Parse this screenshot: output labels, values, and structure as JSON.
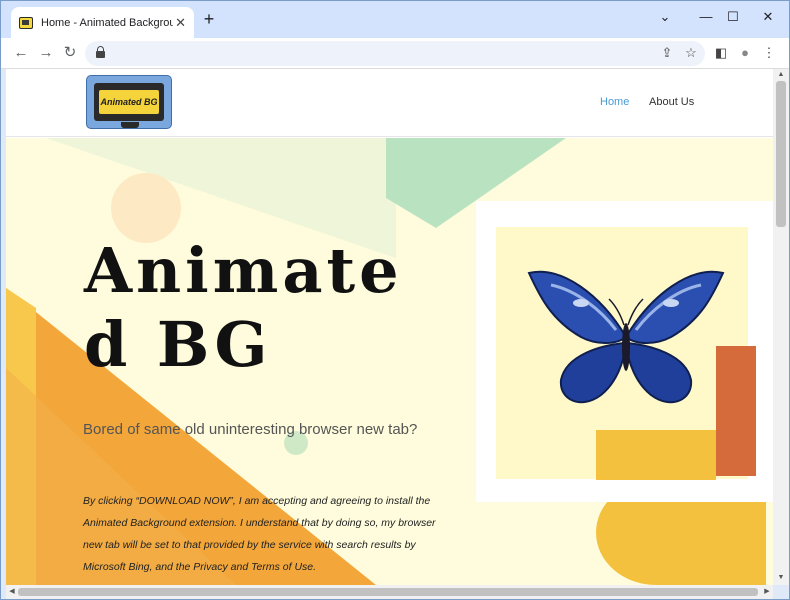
{
  "browser": {
    "tab_title": "Home - Animated Background Ta",
    "tab_close": "✕",
    "new_tab": "+",
    "minimize": "⌄",
    "min_icon": "—",
    "maximize": "☐",
    "close": "✕",
    "back": "←",
    "forward": "→",
    "reload": "↻",
    "share": "⇪",
    "bookmark": "☆",
    "sidepanel": "◧",
    "profile": "●",
    "menu": "⋮"
  },
  "site": {
    "logo_text": "Animated BG",
    "nav": [
      {
        "label": "Home",
        "active": true
      },
      {
        "label": "About Us",
        "active": false
      }
    ]
  },
  "hero": {
    "title": "Animate d BG",
    "subtitle": "Bored of same old uninteresting browser new tab?",
    "disclaimer": "By clicking “DOWNLOAD NOW”, I am accepting and agreeing to install the Animated Background extension. I understand that by doing so, my browser new tab will be set to that provided by the service with search results by Microsoft Bing, and the Privacy and Terms of Use."
  },
  "colors": {
    "accent_link": "#4a9ad4",
    "hero_bg": "#fefcdc",
    "orange": "#f3a63a",
    "green": "#b9e3c0"
  },
  "icons": [
    "favicon-icon",
    "close-icon",
    "plus-icon",
    "back-icon",
    "forward-icon",
    "reload-icon",
    "lock-icon",
    "share-icon",
    "star-icon",
    "sidepanel-icon",
    "profile-icon",
    "menu-icon",
    "butterfly-icon"
  ]
}
